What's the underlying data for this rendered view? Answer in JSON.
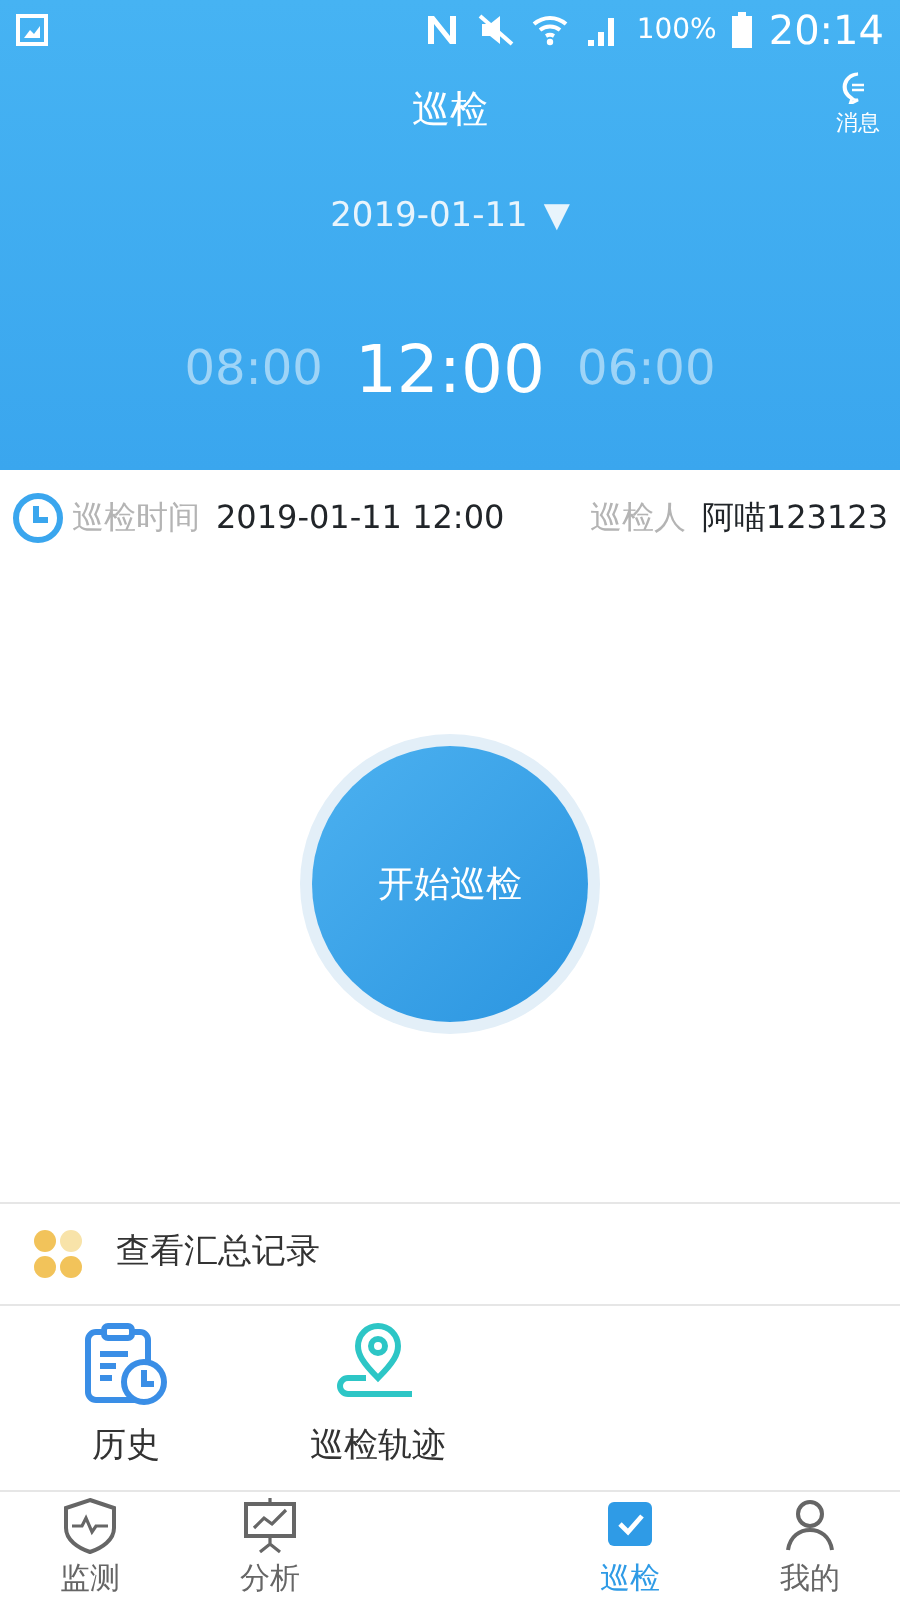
{
  "status_bar": {
    "battery": "100%",
    "time": "20:14"
  },
  "header": {
    "title": "巡检",
    "message_label": "消息",
    "date": "2019-01-11",
    "date_caret": "▼",
    "times": [
      {
        "text": "08:00",
        "selected": false
      },
      {
        "text": "12:00",
        "selected": true
      },
      {
        "text": "06:00",
        "selected": false
      }
    ]
  },
  "info": {
    "time_label": "巡检时间",
    "time_value": "2019-01-11 12:00",
    "person_label": "巡检人",
    "person_value": "阿喵123123"
  },
  "start_button": "开始巡检",
  "summary_link": "查看汇总记录",
  "shortcuts": [
    {
      "label": "历史",
      "kind": "history"
    },
    {
      "label": "巡检轨迹",
      "kind": "track"
    }
  ],
  "tabs": [
    {
      "label": "监测",
      "kind": "monitor",
      "selected": false
    },
    {
      "label": "分析",
      "kind": "analysis",
      "selected": false
    },
    {
      "label": "巡检",
      "kind": "patrol",
      "selected": true
    },
    {
      "label": "我的",
      "kind": "me",
      "selected": false
    }
  ]
}
